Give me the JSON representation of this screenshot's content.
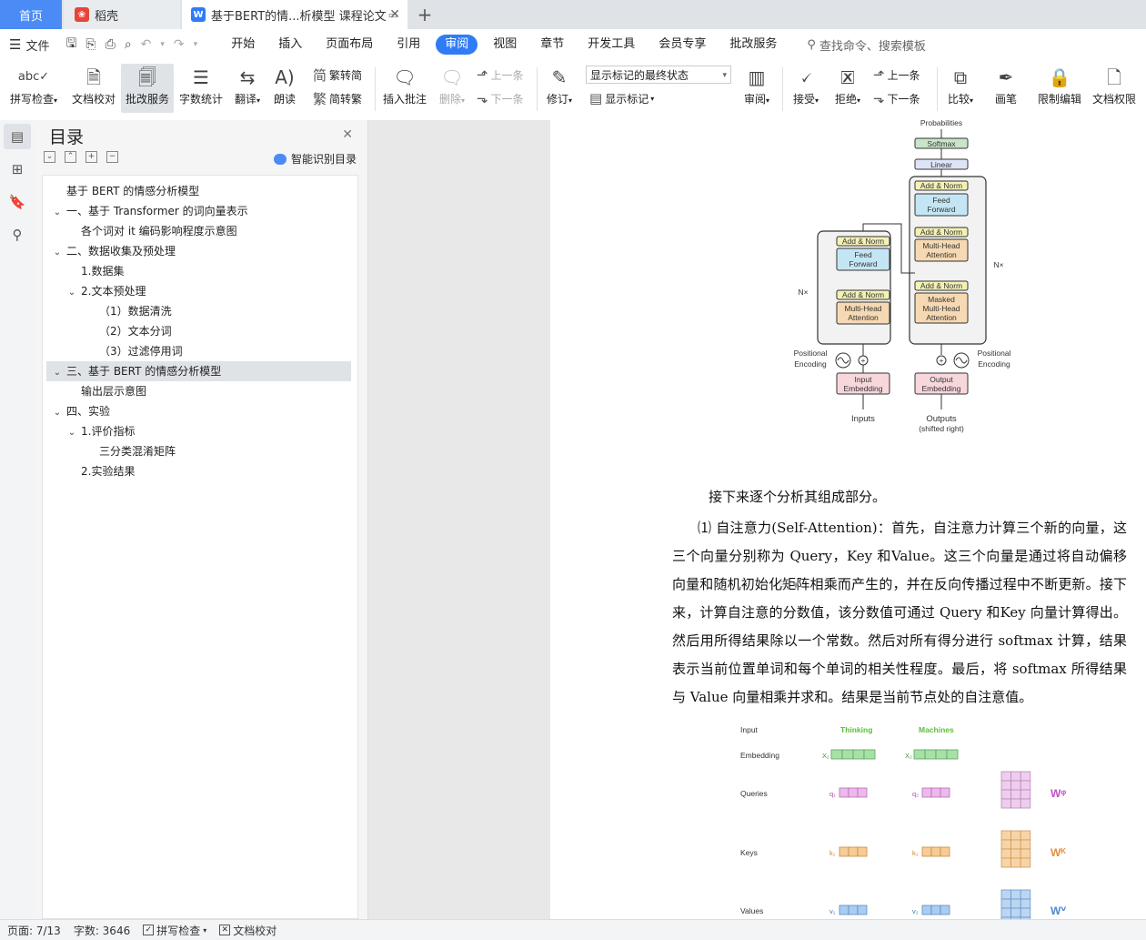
{
  "tabs": {
    "home": "首页",
    "daoke": "稻壳",
    "doc": "基于BERT的情...析模型 课程论文"
  },
  "menu": {
    "file": "文件",
    "items": [
      "开始",
      "插入",
      "页面布局",
      "引用",
      "审阅",
      "视图",
      "章节",
      "开发工具",
      "会员专享",
      "批改服务"
    ],
    "active": "审阅",
    "search_placeholder": "查找命令、搜索模板"
  },
  "ribbon": {
    "spell_check": "拼写检查",
    "doc_proof": "文档校对",
    "correction_service": "批改服务",
    "word_count": "字数统计",
    "translate": "翻译",
    "read_aloud": "朗读",
    "trad_to_simp": "繁转简",
    "simp_to_trad": "简转繁",
    "insert_comment": "插入批注",
    "delete": "删除",
    "prev": "上一条",
    "next": "下一条",
    "track_changes": "修订",
    "markup_state": "显示标记的最终状态",
    "show_markup": "显示标记",
    "review": "审阅",
    "accept": "接受",
    "reject": "拒绝",
    "prev2": "上一条",
    "next2": "下一条",
    "compare": "比较",
    "ink": "画笔",
    "restrict_edit": "限制编辑",
    "doc_permission": "文档权限"
  },
  "nav": {
    "title": "目录",
    "smart_toc": "智能识别目录",
    "items": [
      {
        "label": "基于 BERT 的情感分析模型",
        "chevron": false,
        "level": 0
      },
      {
        "label": "一、基于 Transformer 的词向量表示",
        "chevron": true,
        "level": 0
      },
      {
        "label": "各个词对 it 编码影响程度示意图",
        "chevron": false,
        "level": 1
      },
      {
        "label": "二、数据收集及预处理",
        "chevron": true,
        "level": 0
      },
      {
        "label": "1.数据集",
        "chevron": false,
        "level": 1
      },
      {
        "label": "2.文本预处理",
        "chevron": true,
        "level": 1
      },
      {
        "label": "（1）数据清洗",
        "chevron": false,
        "level": 2
      },
      {
        "label": "（2）文本分词",
        "chevron": false,
        "level": 2
      },
      {
        "label": "（3）过滤停用词",
        "chevron": false,
        "level": 2
      },
      {
        "label": "三、基于 BERT 的情感分析模型",
        "chevron": true,
        "level": 0,
        "selected": true
      },
      {
        "label": "输出层示意图",
        "chevron": false,
        "level": 1
      },
      {
        "label": "四、实验",
        "chevron": true,
        "level": 0
      },
      {
        "label": "1.评价指标",
        "chevron": true,
        "level": 1
      },
      {
        "label": "三分类混淆矩阵",
        "chevron": false,
        "level": 2
      },
      {
        "label": "2.实验结果",
        "chevron": false,
        "level": 1
      }
    ]
  },
  "document": {
    "para1": "接下来逐个分析其组成部分。",
    "para2": "⑴  自注意力(Self-Attention)：首先，自注意力计算三个新的向量，这三个向量分别称为 Query，Key 和Value。这三个向量是通过将自动偏移向量和随机初始化矩阵相乘而产生的，并在反向传播过程中不断更新。接下来，计算自注意的分数值，该分数值可通过 Query 和Key 向量计算得出。然后用所得结果除以一个常数。然后对所有得分进行 softmax 计算，结果表示当前位置单词和每个单词的相关性程度。最后，将 softmax 所得结果与 Value 向量相乘并求和。结果是当前节点处的自注意值。",
    "transformer": {
      "probabilities": "Probabilities",
      "softmax": "Softmax",
      "linear": "Linear",
      "add_norm": "Add & Norm",
      "feed": "Feed",
      "forward": "Forward",
      "multi": "Multi-Head",
      "attention": "Attention",
      "masked": "Masked",
      "nx": "N×",
      "positional": "Positional",
      "encoding": "Encoding",
      "input": "Input",
      "output": "Output",
      "embedding": "Embedding",
      "inputs": "Inputs",
      "outputs": "Outputs",
      "shifted": "(shifted right)"
    },
    "attention_fig": {
      "input": "Input",
      "thinking": "Thinking",
      "machines": "Machines",
      "embedding": "Embedding",
      "queries": "Queries",
      "keys": "Keys",
      "values": "Values",
      "x1": "X₁",
      "x2": "X₂",
      "q1": "q₁",
      "q2": "q₂",
      "k1": "k₁",
      "k2": "k₂",
      "v1": "v₁",
      "v2": "v₂",
      "wq": "Wᵠ",
      "wk": "Wᴷ",
      "wv": "Wⱽ"
    }
  },
  "status": {
    "page": "页面: 7/13",
    "words": "字数: 3646",
    "spell": "拼写检查",
    "proof": "文档校对"
  }
}
